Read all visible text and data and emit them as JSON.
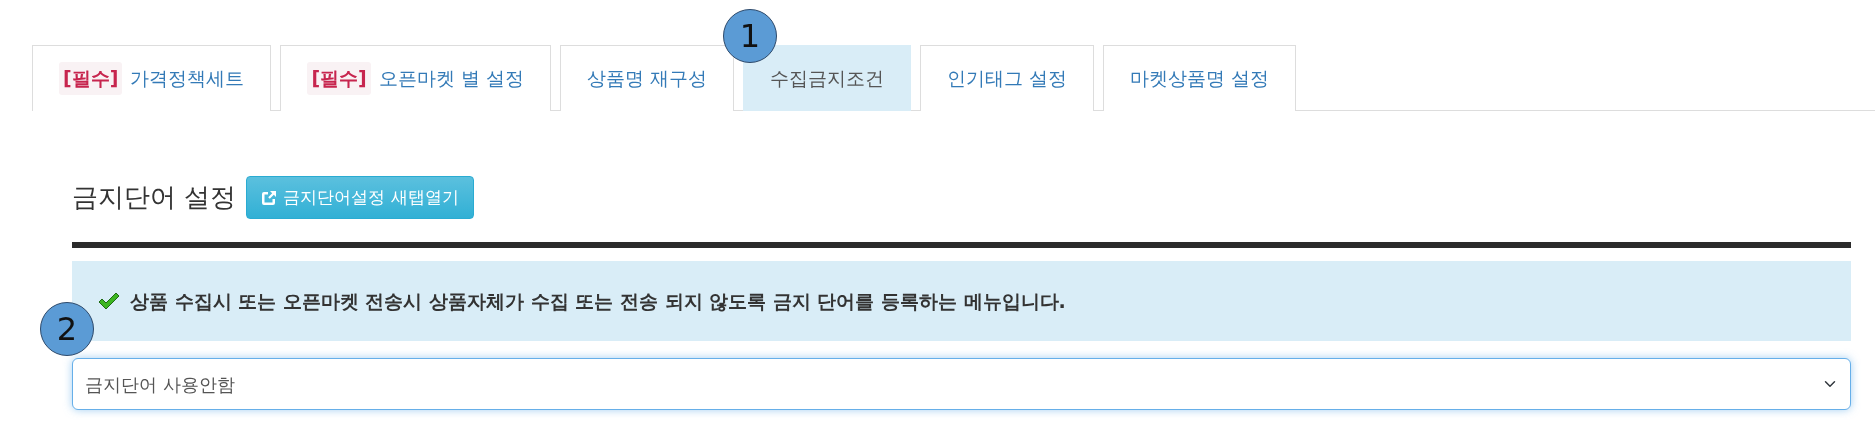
{
  "tabs": [
    {
      "tag": "[필수]",
      "label": "가격정책세트",
      "selected": false
    },
    {
      "tag": "[필수]",
      "label": "오픈마켓 별 설정",
      "selected": false
    },
    {
      "label": "상품명 재구성",
      "selected": false
    },
    {
      "label": "수집금지조건",
      "selected": true,
      "callout": "1"
    },
    {
      "label": "인기태그 설정",
      "selected": false
    },
    {
      "label": "마켓상품명 설정",
      "selected": false
    }
  ],
  "section": {
    "title": "금지단어 설정",
    "button": "금지단어설정 새탭열기"
  },
  "info": {
    "text": "상품 수집시 또는 오픈마켓 전송시 상품자체가 수집 또는 전송 되지 않도록 금지 단어를 등록하는 메뉴입니다."
  },
  "select": {
    "value": "금지단어 사용안함",
    "callout": "2"
  }
}
